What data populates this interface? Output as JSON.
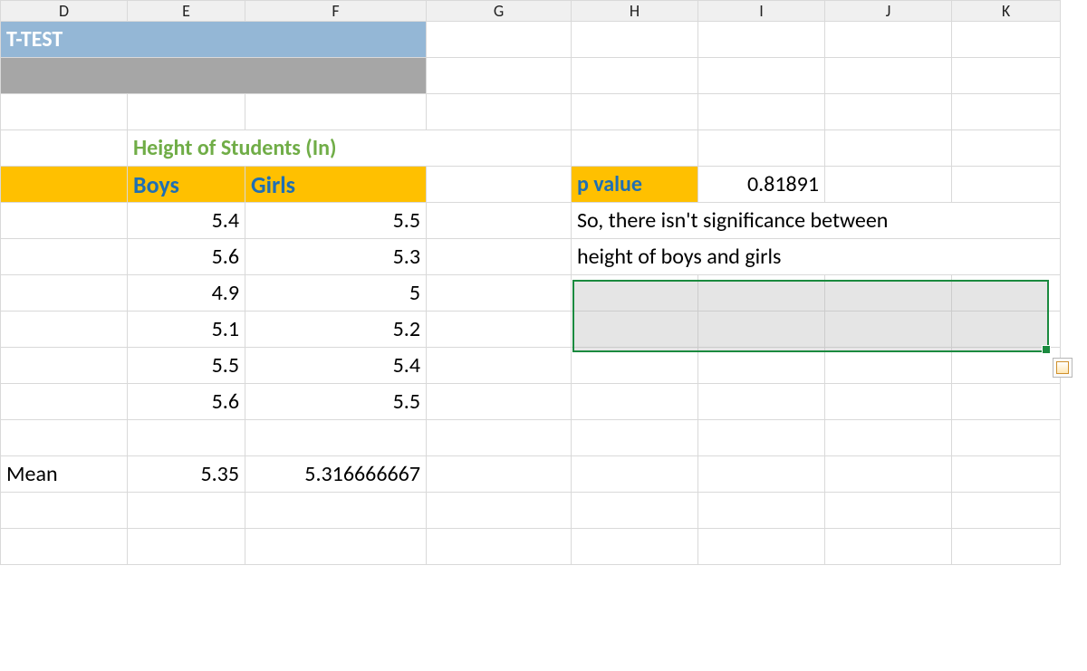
{
  "columns": {
    "D": "D",
    "E": "E",
    "F": "F",
    "G": "G",
    "H": "H",
    "I": "I",
    "J": "J",
    "K": "K"
  },
  "title": "T-TEST",
  "section_title": "Height of Students (In)",
  "headers": {
    "boys": "Boys",
    "girls": "Girls"
  },
  "data": {
    "boys": [
      "5.4",
      "5.6",
      "4.9",
      "5.1",
      "5.5",
      "5.6"
    ],
    "girls": [
      "5.5",
      "5.3",
      "5",
      "5.2",
      "5.4",
      "5.5"
    ]
  },
  "mean": {
    "label": "Mean",
    "boys": "5.35",
    "girls": "5.316666667"
  },
  "pvalue": {
    "label": "p value",
    "value": "0.81891"
  },
  "conclusion": {
    "line1": "So, there isn't significance between",
    "line2": "height of boys and girls"
  },
  "chart_data": {
    "type": "table",
    "title": "Height of Students (In)",
    "series": [
      {
        "name": "Boys",
        "values": [
          5.4,
          5.6,
          4.9,
          5.1,
          5.5,
          5.6
        ],
        "mean": 5.35
      },
      {
        "name": "Girls",
        "values": [
          5.5,
          5.3,
          5.0,
          5.2,
          5.4,
          5.5
        ],
        "mean": 5.316666667
      }
    ],
    "t_test": {
      "p_value": 0.81891
    }
  }
}
